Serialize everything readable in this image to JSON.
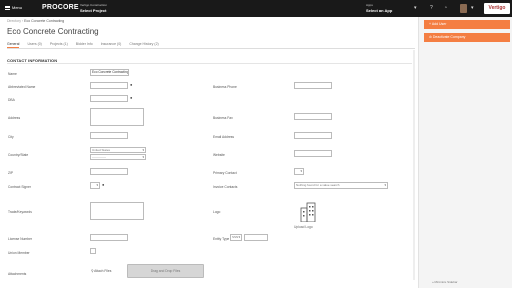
{
  "topbar": {
    "menu_label": "Menu",
    "logo": "PROCORE",
    "company": "Vertigo Construction",
    "project": "Select Project",
    "app_caption": "Apps",
    "app_select": "Select an App",
    "brand": "Vertigo"
  },
  "breadcrumb": {
    "root": "Directory",
    "sep": "›",
    "current": "Eco Concrete Contracting"
  },
  "page_title": "Eco Concrete Contracting",
  "tabs": [
    "General",
    "Users (0)",
    "Projects (1)",
    "Bidder Info",
    "Insurance (0)",
    "Change History (2)"
  ],
  "section_title": "CONTACT INFORMATION",
  "form": {
    "name_label": "Name",
    "name_value": "Eco Concrete Contracting",
    "abbrev_label": "Abbreviated Name",
    "dba_label": "DBA",
    "address_label": "Address",
    "city_label": "City",
    "country_label": "Country/State",
    "country_value": "United States",
    "state_value": "--------------",
    "zip_label": "ZIP",
    "contract_signer_label": "Contract Signer",
    "trade_label": "Trade/Keywords",
    "license_label": "License Number",
    "union_label": "Union Member",
    "attachments_label": "Attachments",
    "attach_link": "Attach Files",
    "dropzone": "Drag and Drop Files",
    "business_phone_label": "Business Phone",
    "business_fax_label": "Business Fax",
    "email_label": "Email Address",
    "website_label": "Website",
    "primary_contact_label": "Primary Contact",
    "invoice_contacts_label": "Invoice Contacts",
    "invoice_placeholder": "Nothing found for a value search",
    "logo_label": "Logo",
    "upload_logo": "Upload Logo",
    "entity_type_label": "Entity Type",
    "entity_type_value": "SSN"
  },
  "rail": {
    "add_user": "Add User",
    "deactivate": "Deactivate Company",
    "disable": "Minimize Sidebar"
  },
  "colors": {
    "accent": "#f47e42",
    "topbar": "#191919"
  }
}
